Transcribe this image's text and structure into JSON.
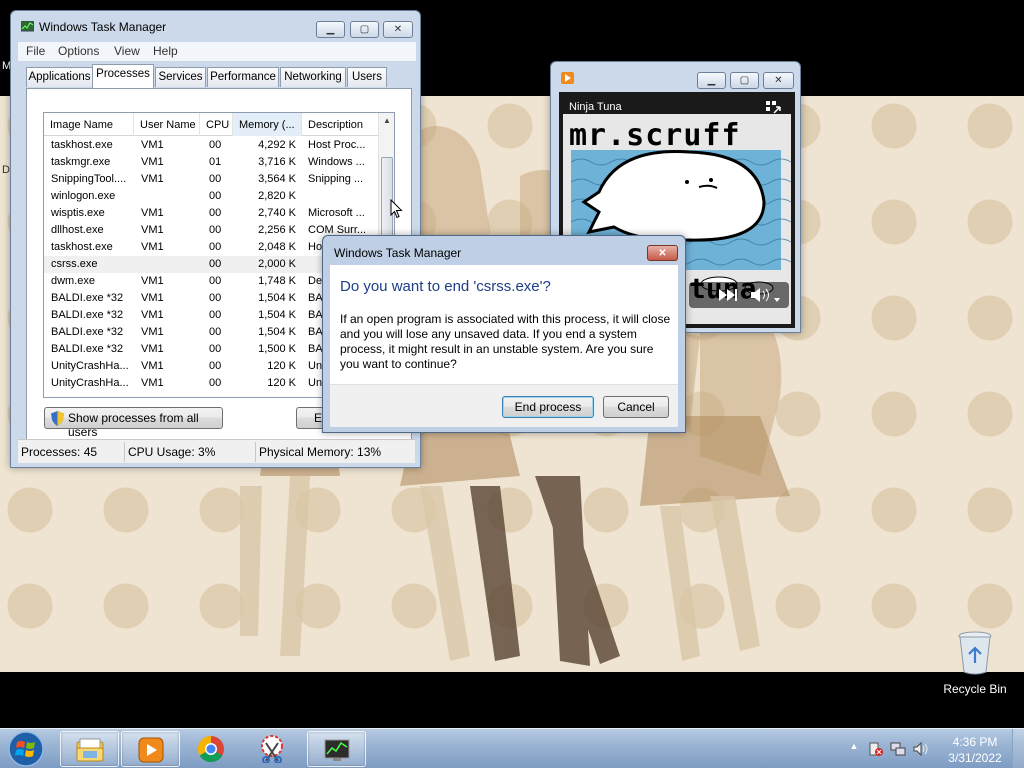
{
  "desktop": {
    "edge_labels": [
      "M",
      "D"
    ],
    "recycle_bin_label": "Recycle Bin"
  },
  "task_manager": {
    "title": "Windows Task Manager",
    "menu": [
      "File",
      "Options",
      "View",
      "Help"
    ],
    "tabs": [
      "Applications",
      "Processes",
      "Services",
      "Performance",
      "Networking",
      "Users"
    ],
    "active_tab": "Processes",
    "columns": [
      "Image Name",
      "User Name",
      "CPU",
      "Memory (...",
      "Description"
    ],
    "sorted_column": "Memory (...",
    "rows": [
      {
        "name": "taskhost.exe",
        "user": "VM1",
        "cpu": "00",
        "mem": "4,292 K",
        "desc": "Host Proc..."
      },
      {
        "name": "taskmgr.exe",
        "user": "VM1",
        "cpu": "01",
        "mem": "3,716 K",
        "desc": "Windows ..."
      },
      {
        "name": "SnippingTool....",
        "user": "VM1",
        "cpu": "00",
        "mem": "3,564 K",
        "desc": "Snipping ..."
      },
      {
        "name": "winlogon.exe",
        "user": "",
        "cpu": "00",
        "mem": "2,820 K",
        "desc": ""
      },
      {
        "name": "wisptis.exe",
        "user": "VM1",
        "cpu": "00",
        "mem": "2,740 K",
        "desc": "Microsoft ..."
      },
      {
        "name": "dllhost.exe",
        "user": "VM1",
        "cpu": "00",
        "mem": "2,256 K",
        "desc": "COM Surr..."
      },
      {
        "name": "taskhost.exe",
        "user": "VM1",
        "cpu": "00",
        "mem": "2,048 K",
        "desc": "Hos"
      },
      {
        "name": "csrss.exe",
        "user": "",
        "cpu": "00",
        "mem": "2,000 K",
        "desc": ""
      },
      {
        "name": "dwm.exe",
        "user": "VM1",
        "cpu": "00",
        "mem": "1,748 K",
        "desc": "Des"
      },
      {
        "name": "BALDI.exe *32",
        "user": "VM1",
        "cpu": "00",
        "mem": "1,504 K",
        "desc": "BAL"
      },
      {
        "name": "BALDI.exe *32",
        "user": "VM1",
        "cpu": "00",
        "mem": "1,504 K",
        "desc": "BAL"
      },
      {
        "name": "BALDI.exe *32",
        "user": "VM1",
        "cpu": "00",
        "mem": "1,504 K",
        "desc": "BAL"
      },
      {
        "name": "BALDI.exe *32",
        "user": "VM1",
        "cpu": "00",
        "mem": "1,500 K",
        "desc": "BAL"
      },
      {
        "name": "UnityCrashHa...",
        "user": "VM1",
        "cpu": "00",
        "mem": "120 K",
        "desc": "Uni"
      },
      {
        "name": "UnityCrashHa...",
        "user": "VM1",
        "cpu": "00",
        "mem": "120 K",
        "desc": "Uni"
      }
    ],
    "selected_row": 7,
    "show_all_button": "Show processes from all users",
    "end_process_button_partial": "E",
    "status": {
      "processes": "Processes: 45",
      "cpu": "CPU Usage: 3%",
      "memory": "Physical Memory: 13%"
    }
  },
  "media_player": {
    "album_title": "Ninja Tuna",
    "art_text_top": "mr.scruff",
    "art_text_bottom": "tuna"
  },
  "dialog": {
    "title": "Windows Task Manager",
    "heading": "Do you want to end 'csrss.exe'?",
    "body": "If an open program is associated with this process, it will close and you will lose any unsaved data. If you end a system process, it might result in an unstable system. Are you sure you want to continue?",
    "confirm_button": "End process",
    "cancel_button": "Cancel"
  },
  "taskbar": {
    "pinned": [
      {
        "icon": "windows-explorer-icon",
        "open": true
      },
      {
        "icon": "media-player-icon",
        "open": true
      },
      {
        "icon": "chrome-icon",
        "open": false
      },
      {
        "icon": "snipping-tool-icon",
        "open": false
      },
      {
        "icon": "task-manager-icon",
        "open": true
      }
    ],
    "clock_time": "4:36 PM",
    "clock_date": "3/31/2022"
  }
}
